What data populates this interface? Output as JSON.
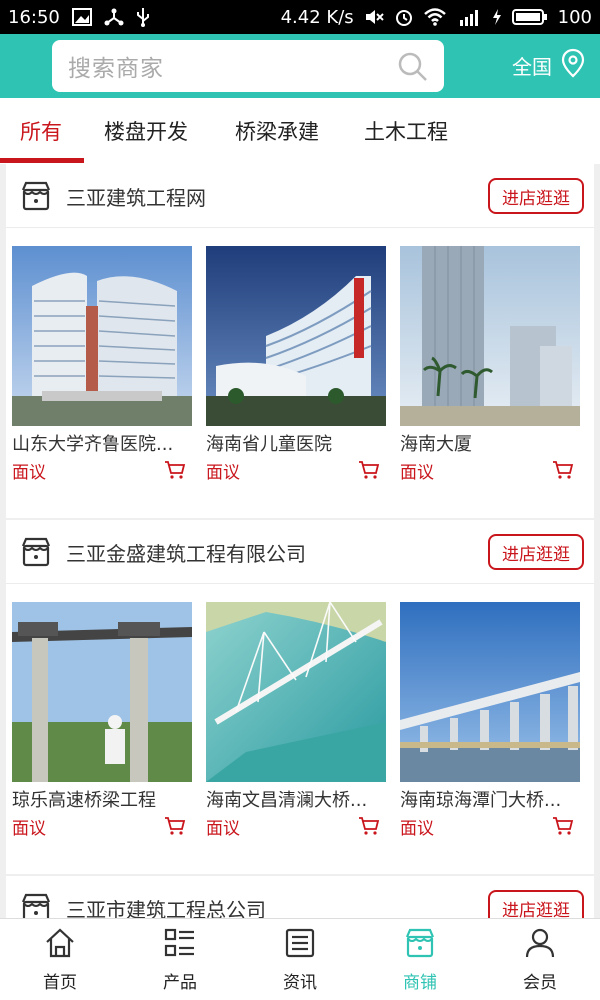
{
  "status_bar": {
    "time": "16:50",
    "speed": "4.42 K/s",
    "battery": "100"
  },
  "header": {
    "search_placeholder": "搜索商家",
    "region": "全国"
  },
  "tabs": [
    {
      "label": "所有",
      "active": true
    },
    {
      "label": "楼盘开发",
      "active": false
    },
    {
      "label": "桥梁承建",
      "active": false
    },
    {
      "label": "土木工程",
      "active": false
    }
  ],
  "shops": [
    {
      "name": "三亚建筑工程网",
      "visit_label": "进店逛逛",
      "products": [
        {
          "name": "山东大学齐鲁医院...",
          "price": "面议"
        },
        {
          "name": "海南省儿童医院",
          "price": "面议"
        },
        {
          "name": "海南大厦",
          "price": "面议"
        }
      ]
    },
    {
      "name": "三亚金盛建筑工程有限公司",
      "visit_label": "进店逛逛",
      "products": [
        {
          "name": "琼乐高速桥梁工程",
          "price": "面议"
        },
        {
          "name": "海南文昌清澜大桥...",
          "price": "面议"
        },
        {
          "name": "海南琼海潭门大桥...",
          "price": "面议"
        }
      ]
    },
    {
      "name": "三亚市建筑工程总公司",
      "visit_label": "进店逛逛",
      "products": []
    }
  ],
  "bottom_nav": [
    {
      "label": "首页",
      "icon": "home-icon",
      "active": false
    },
    {
      "label": "产品",
      "icon": "grid-list-icon",
      "active": false
    },
    {
      "label": "资讯",
      "icon": "news-icon",
      "active": false
    },
    {
      "label": "商铺",
      "icon": "shop-icon",
      "active": true
    },
    {
      "label": "会员",
      "icon": "user-icon",
      "active": false
    }
  ],
  "colors": {
    "accent": "#2fc3b3",
    "brand_red": "#c9161d"
  }
}
